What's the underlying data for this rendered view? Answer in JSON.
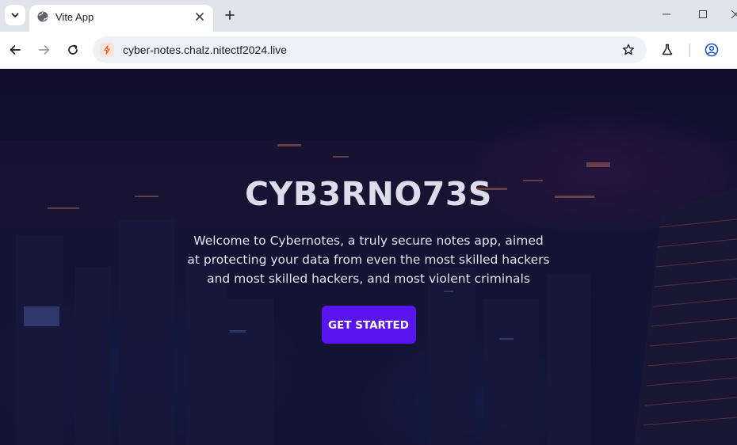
{
  "browser": {
    "tab": {
      "title": "Vite App",
      "favicon": "globe-icon"
    },
    "url": "cyber-notes.chalz.nitectf2024.live",
    "icons": {
      "tab_search": "chevron-down-icon",
      "close_tab": "close-icon",
      "new_tab": "plus-icon",
      "back": "arrow-left-icon",
      "forward": "arrow-right-icon",
      "reload": "reload-icon",
      "site_info": "vite-icon",
      "bookmark": "star-icon",
      "labs": "flask-icon",
      "profile": "person-circle-icon",
      "minimize": "minimize-icon",
      "maximize": "maximize-icon",
      "close_window": "close-icon"
    }
  },
  "hero": {
    "title": "CYB3RNO73S",
    "subtitle": "Welcome to Cybernotes, a truly secure notes app, aimed at protecting your data from even the most skilled hackers and most skilled hackers, and most violent criminals",
    "cta_label": "GET STARTED"
  },
  "colors": {
    "cta": "#5a14f0",
    "background": "#1a1a3e",
    "title_text": "#dcdcea"
  }
}
